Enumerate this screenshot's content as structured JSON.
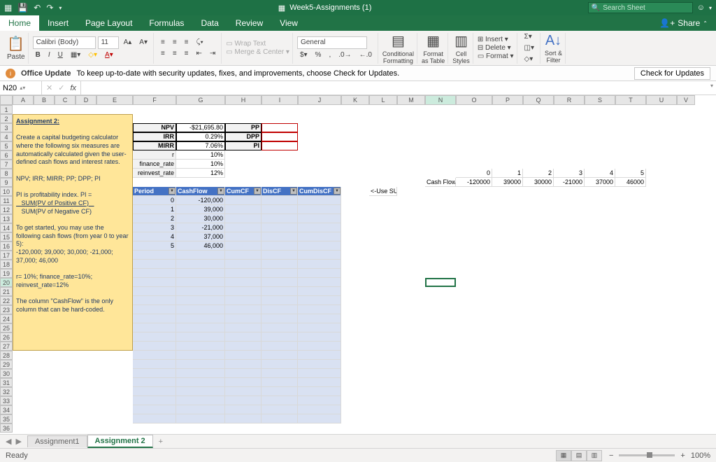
{
  "titlebar": {
    "filename": "Week5-Assignments (1)",
    "search_placeholder": "Search Sheet"
  },
  "tabs": [
    "Home",
    "Insert",
    "Page Layout",
    "Formulas",
    "Data",
    "Review",
    "View"
  ],
  "active_tab": "Home",
  "share_label": "Share",
  "ribbon": {
    "paste": "Paste",
    "font_name": "Calibri (Body)",
    "font_size": "11",
    "wrap": "Wrap Text",
    "merge": "Merge & Center",
    "number_format": "General",
    "cond_fmt": "Conditional\nFormatting",
    "fmt_table": "Format\nas Table",
    "cell_styles": "Cell\nStyles",
    "insert": "Insert",
    "delete": "Delete",
    "format": "Format",
    "sort": "Sort &\nFilter"
  },
  "update": {
    "title": "Office Update",
    "msg": "To keep up-to-date with security updates, fixes, and improvements, choose Check for Updates.",
    "btn": "Check for Updates"
  },
  "name_box": "N20",
  "cols": [
    "A",
    "B",
    "C",
    "D",
    "E",
    "F",
    "G",
    "H",
    "I",
    "J",
    "K",
    "L",
    "M",
    "N",
    "O",
    "P",
    "Q",
    "R",
    "S",
    "T",
    "U",
    "V"
  ],
  "note": {
    "title": "Assignment 2:",
    "p1": "Create a capital budgeting calculator where the following six measures are automatically calculated given the user-defined cash flows and interest rates.",
    "p2": "NPV; IRR; MIRR; PP; DPP; PI",
    "p3": "PI is profitability index. PI =",
    "p3a": "SUM(PV of Positive CF)",
    "p3b": "SUM(PV of Negative CF)",
    "p4": "To get started, you may use the following cash flows (from year 0 to year 5):",
    "p5": "-120,000; 39,000; 30,000; -21,000; 37,000; 46,000",
    "p6": "r= 10%; finance_rate=10%; reinvest_rate=12%",
    "p7": "The column \"CashFlow\" is the only column that can be hard-coded."
  },
  "outputs": {
    "npv_label": "NPV",
    "npv": "-$21,695.80",
    "pp_label": "PP",
    "irr_label": "IRR",
    "irr": "0.29%",
    "dpp_label": "DPP",
    "mirr_label": "MIRR",
    "mirr": "7.06%",
    "pi_label": "PI"
  },
  "rates": {
    "r_label": "r",
    "r": "10%",
    "fin_label": "finance_rate",
    "fin": "10%",
    "re_label": "reinvest_rate",
    "re": "12%"
  },
  "table": {
    "headers": [
      "Period",
      "CashFlow",
      "CumCF",
      "DisCF",
      "CumDisCF"
    ],
    "rows": [
      [
        "0",
        "-120,000",
        "",
        "",
        ""
      ],
      [
        "1",
        "39,000",
        "",
        "",
        ""
      ],
      [
        "2",
        "30,000",
        "",
        "",
        ""
      ],
      [
        "3",
        "-21,000",
        "",
        "",
        ""
      ],
      [
        "4",
        "37,000",
        "",
        "",
        ""
      ],
      [
        "5",
        "46,000",
        "",
        "",
        ""
      ]
    ]
  },
  "sumif_hint": "<-Use SUMIF",
  "cf_sidebar": {
    "label": "Cash Flows",
    "years": [
      "0",
      "1",
      "2",
      "3",
      "4",
      "5"
    ],
    "values": [
      "-120000",
      "39000",
      "30000",
      "-21000",
      "37000",
      "46000"
    ]
  },
  "sheets": {
    "tabs": [
      "Assignment1",
      "Assignment 2"
    ],
    "active": 1
  },
  "status": {
    "ready": "Ready",
    "zoom": "100%"
  },
  "chart_data": null
}
